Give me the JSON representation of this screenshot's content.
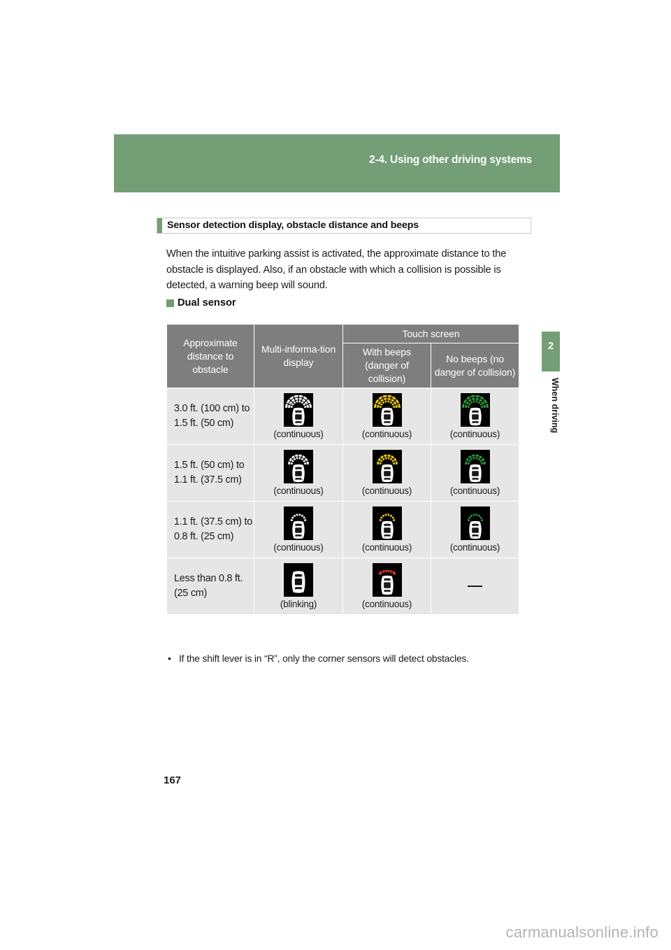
{
  "header": {
    "breadcrumb": "2-4. Using other driving systems"
  },
  "chapter_tab": {
    "number": "2",
    "label": "When driving"
  },
  "section": {
    "title": "Sensor detection display, obstacle distance and beeps"
  },
  "body": {
    "paragraph": "When the intuitive parking assist is activated, the approximate distance to the obstacle is displayed. Also, if an obstacle with which a collision is possible is detected, a warning beep will sound."
  },
  "subheading": {
    "label": "Dual sensor"
  },
  "table": {
    "headers": {
      "col1": "Approximate distance to obstacle",
      "col2": "Multi-informa-tion display",
      "group": "Touch screen",
      "col3": "With beeps (danger of collision)",
      "col4": "No beeps (no danger of collision)"
    },
    "rows": [
      {
        "distance": "3.0 ft. (100 cm) to 1.5 ft. (50 cm)",
        "mid": {
          "icon": "car-sensor-arcs-white-3",
          "caption": "(continuous)",
          "arcs": 3,
          "color": "#ffffff"
        },
        "beeps": {
          "icon": "car-sensor-arcs-yellow-3",
          "caption": "(continuous)",
          "arcs": 3,
          "color": "#f2cf1a"
        },
        "nobeeps": {
          "icon": "car-sensor-arcs-green-3",
          "caption": "(continuous)",
          "arcs": 3,
          "color": "#2f9e3f"
        }
      },
      {
        "distance": "1.5 ft. (50 cm) to 1.1 ft. (37.5 cm)",
        "mid": {
          "icon": "car-sensor-arcs-white-2",
          "caption": "(continuous)",
          "arcs": 2,
          "color": "#ffffff"
        },
        "beeps": {
          "icon": "car-sensor-arcs-yellow-2",
          "caption": "(continuous)",
          "arcs": 2,
          "color": "#f2cf1a"
        },
        "nobeeps": {
          "icon": "car-sensor-arcs-green-2",
          "caption": "(continuous)",
          "arcs": 2,
          "color": "#2f9e3f"
        }
      },
      {
        "distance": "1.1 ft. (37.5 cm) to 0.8 ft. (25 cm)",
        "mid": {
          "icon": "car-sensor-arcs-white-1",
          "caption": "(continuous)",
          "arcs": 1,
          "color": "#ffffff"
        },
        "beeps": {
          "icon": "car-sensor-arcs-yellow-1",
          "caption": "(continuous)",
          "arcs": 1,
          "color": "#f2cf1a"
        },
        "nobeeps": {
          "icon": "car-sensor-arcs-green-1",
          "caption": "(continuous)",
          "arcs": 1,
          "color": "#2f9e3f"
        }
      },
      {
        "distance": "Less than 0.8 ft. (25 cm)",
        "mid": {
          "icon": "car-sensor-blinking",
          "caption": "(blinking)",
          "arcs": 0,
          "color": "#ffffff"
        },
        "beeps": {
          "icon": "car-sensor-arc-red",
          "caption": "(continuous)",
          "arcs": 1,
          "color": "#e8342a"
        },
        "nobeeps": {
          "icon": "dash",
          "caption": "",
          "arcs": 0,
          "color": ""
        }
      }
    ]
  },
  "note": {
    "bullet": "•",
    "text": "If the shift lever is in “R”, only the corner sensors will detect obstacles."
  },
  "footer": {
    "page_number": "167",
    "watermark": "carmanualsonline.info"
  },
  "colors": {
    "brand_green": "#749e75",
    "header_gray": "#7e7e7e",
    "cell_gray": "#e6e6e6",
    "warn_yellow": "#f2cf1a",
    "safe_green": "#2f9e3f",
    "danger_red": "#e8342a"
  }
}
